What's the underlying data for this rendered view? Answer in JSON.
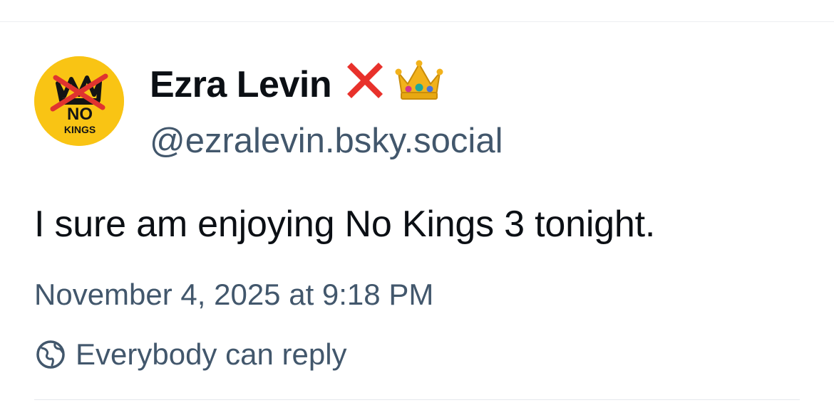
{
  "post": {
    "author": {
      "display_name": "Ezra Levin",
      "handle": "@ezralevin.bsky.social",
      "name_emojis": [
        "cross-mark-icon",
        "crown-icon"
      ],
      "avatar": {
        "icon": "no-kings-logo",
        "text_line1": "NO",
        "text_line2": "KINGS",
        "background": "#f9c414"
      }
    },
    "text": "I sure am enjoying No Kings 3 tonight.",
    "timestamp": "November 4, 2025 at 9:18 PM",
    "reply_setting": {
      "icon": "globe-icon",
      "label": "Everybody can reply"
    }
  },
  "colors": {
    "text_primary": "#0b0f14",
    "text_secondary": "#42576c",
    "divider": "#e5e8ec"
  }
}
